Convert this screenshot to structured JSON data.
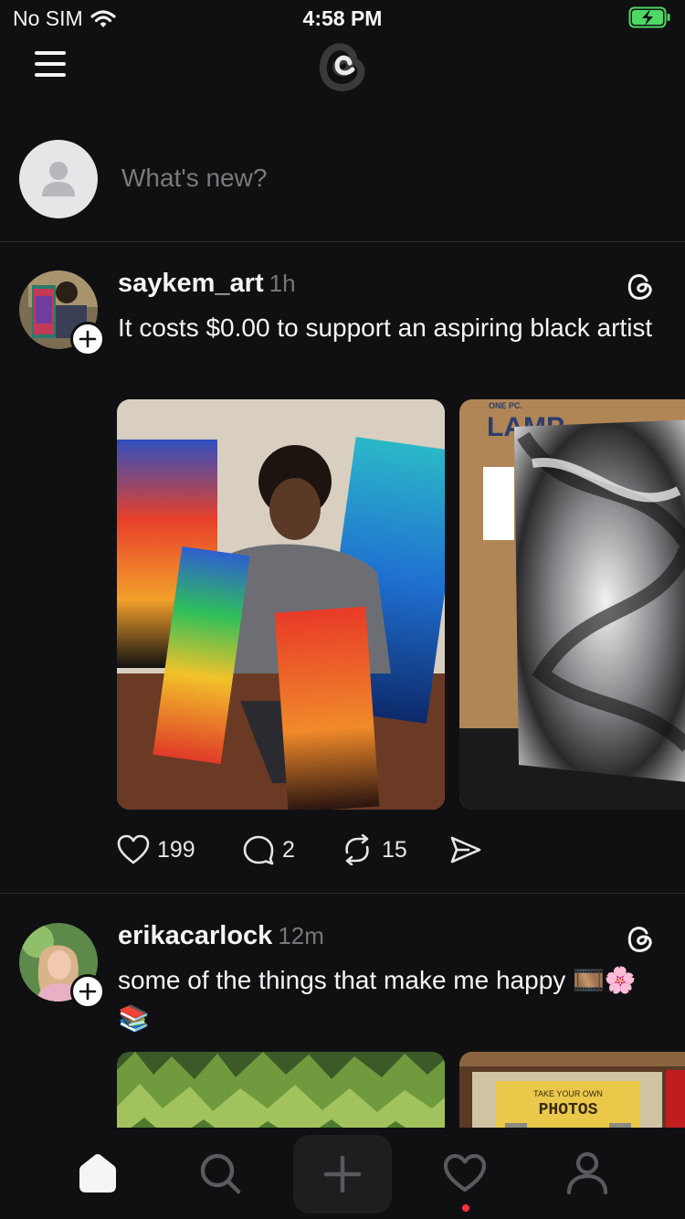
{
  "status_bar": {
    "carrier": "No SIM",
    "time": "4:58 PM"
  },
  "composer": {
    "placeholder": "What's new?"
  },
  "posts": [
    {
      "username": "saykem_art",
      "time": "1h",
      "text": "It costs $0.00 to support an aspiring black artist",
      "likes": "199",
      "replies": "2",
      "reposts": "15",
      "media_text": {
        "sign_top": "ONE PC.",
        "sign_main": "LAMP"
      }
    },
    {
      "username": "erikacarlock",
      "time": "12m",
      "text": "some of the things that make me happy 🎞️🌸📚",
      "media_text": {
        "sign_top": "TAKE YOUR OWN",
        "sign_main": "PHOTOS"
      }
    }
  ],
  "colors": {
    "background": "#101012",
    "text": "#f3f5f7",
    "muted": "#77777b",
    "divider": "#2a2a2d",
    "notification": "#ff3040",
    "battery": "#4cd964"
  },
  "icons": {
    "status": [
      "wifi-icon",
      "battery-charging-icon"
    ],
    "header": [
      "menu-icon",
      "threads-logo-icon"
    ],
    "post": [
      "plus-icon",
      "threads-badge-icon",
      "heart-icon",
      "comment-icon",
      "repost-icon",
      "share-icon"
    ],
    "tabs": [
      "home-icon",
      "search-icon",
      "new-post-icon",
      "activity-icon",
      "profile-icon"
    ]
  }
}
